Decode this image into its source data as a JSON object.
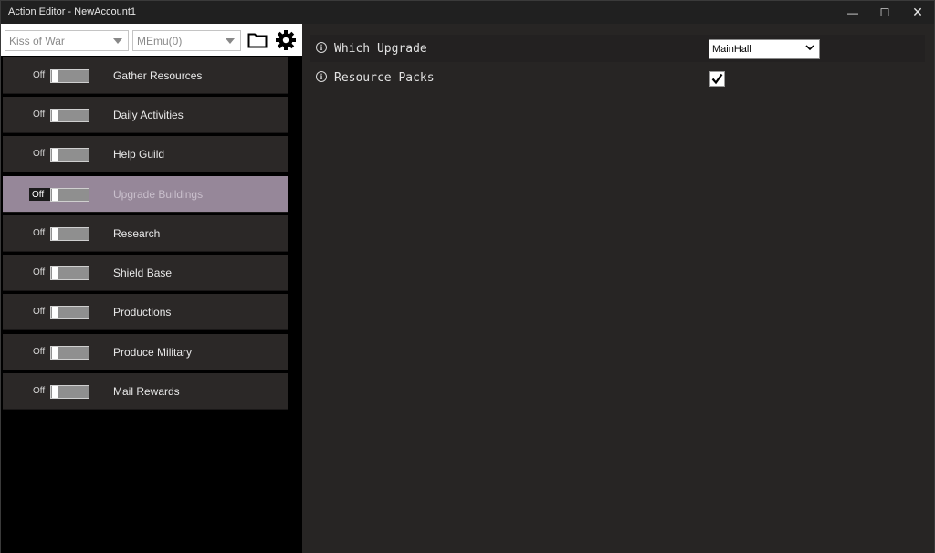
{
  "window": {
    "title": "Action Editor - NewAccount1",
    "controls": {
      "minimize": "—",
      "maximize": "☐",
      "close": "✕"
    }
  },
  "toolbar": {
    "game_select": {
      "value": "Kiss of War"
    },
    "device_select": {
      "value": "MEmu(0)"
    },
    "open_folder_icon": "folder-icon",
    "settings_icon": "gear-icon"
  },
  "actions": [
    {
      "state": "Off",
      "label": "Gather Resources",
      "enabled": false,
      "selected": false
    },
    {
      "state": "Off",
      "label": "Daily Activities",
      "enabled": false,
      "selected": false
    },
    {
      "state": "Off",
      "label": "Help Guild",
      "enabled": false,
      "selected": false
    },
    {
      "state": "Off",
      "label": "Upgrade Buildings",
      "enabled": false,
      "selected": true
    },
    {
      "state": "Off",
      "label": "Research",
      "enabled": false,
      "selected": false
    },
    {
      "state": "Off",
      "label": "Shield Base",
      "enabled": false,
      "selected": false
    },
    {
      "state": "Off",
      "label": "Productions",
      "enabled": false,
      "selected": false
    },
    {
      "state": "Off",
      "label": "Produce Military",
      "enabled": false,
      "selected": false
    },
    {
      "state": "Off",
      "label": "Mail Rewards",
      "enabled": false,
      "selected": false
    }
  ],
  "settings": {
    "which_upgrade": {
      "label": "Which Upgrade",
      "value": "MainHall"
    },
    "resource_packs": {
      "label": "Resource Packs",
      "checked": true
    }
  },
  "colors": {
    "selected_item": "#968799",
    "item_bg": "#2b2827",
    "panel_bg": "#272524"
  }
}
